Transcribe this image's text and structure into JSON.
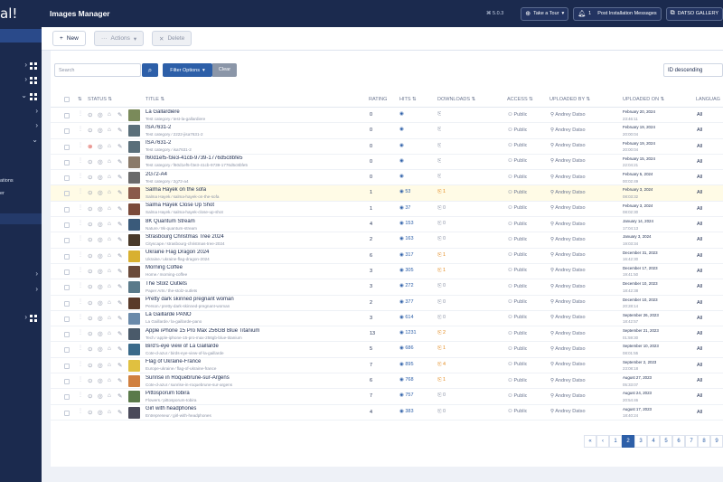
{
  "app": {
    "logo_text": "al!",
    "title": "Images Manager",
    "version": "5.0.3"
  },
  "topbar": {
    "take_tour": "Take a Tour",
    "messages_count": "1",
    "messages_label": "Post Installation Messages",
    "gallery_label": "DATSO GALLERY"
  },
  "sidebar": {
    "text_a": "ations",
    "text_b": "er"
  },
  "toolbar": {
    "new_label": "New",
    "actions_label": "Actions",
    "delete_label": "Delete"
  },
  "filters": {
    "search_placeholder": "Search",
    "filter_options_label": "Filter Options",
    "clear_label": "Clear",
    "sort_value": "ID descending"
  },
  "columns": {
    "status": "STATUS",
    "title": "TITLE",
    "rating": "RATING",
    "hits": "HITS",
    "downloads": "DOWNLOADS",
    "access": "ACCESS",
    "uploaded_by": "UPLOADED BY",
    "uploaded_on": "UPLOADED ON",
    "language": "LANGUAG"
  },
  "rows": [
    {
      "title": "La Gallardière",
      "sub": "Test category  ⁄  test-la-gallardiere",
      "rating": "0",
      "hits": "",
      "downloads": "",
      "access": "Public",
      "by": "Andrey Datso",
      "date": "February 20, 2024",
      "time": "23:46:11",
      "lang": "All",
      "status": "ok",
      "thumb": "#7a8a5a"
    },
    {
      "title": "ISA7631-2",
      "sub": "Test category  ⁄  2222-jisa7631-2",
      "rating": "0",
      "hits": "",
      "downloads": "",
      "access": "Public",
      "by": "Andrey Datso",
      "date": "February 19, 2024",
      "time": "20:00:04",
      "lang": "All",
      "status": "ok",
      "thumb": "#5a6f7a"
    },
    {
      "title": "ISA7631-2",
      "sub": "Test category  ⁄  isa7631-2",
      "rating": "0",
      "hits": "",
      "downloads": "",
      "access": "Public",
      "by": "Andrey Datso",
      "date": "February 19, 2024",
      "time": "20:00:04",
      "lang": "All",
      "status": "err",
      "thumb": "#5a6f7a"
    },
    {
      "title": "f60d1ef5-f3e3-41cb-9739-1776d5c8bfe5",
      "sub": "Test category  ⁄  f60d1ef5-f3e3-41cb-9739-1776d5c8bfe5",
      "rating": "0",
      "hits": "",
      "downloads": "",
      "access": "Public",
      "by": "Andrey Datso",
      "date": "February 15, 2024",
      "time": "22:04:21",
      "lang": "All",
      "status": "ok",
      "thumb": "#8a7a6a"
    },
    {
      "title": "2G72-A4",
      "sub": "Test category  ⁄  2g72-a4",
      "rating": "0",
      "hits": "",
      "downloads": "",
      "access": "Public",
      "by": "Andrey Datso",
      "date": "February 5, 2024",
      "time": "00:02:49",
      "lang": "All",
      "status": "ok",
      "thumb": "#6a6a6a"
    },
    {
      "title": "Salma Hayek on the sofa",
      "sub": "Salma Hayek  ⁄  salma-hayek-on-the-sofa",
      "rating": "1",
      "hits": "53",
      "downloads": "1",
      "access": "Public",
      "by": "Andrey Datso",
      "date": "February 3, 2024",
      "time": "08:03:32",
      "lang": "All",
      "status": "ok",
      "thumb": "#8a5a4a",
      "hl": true
    },
    {
      "title": "Salma Hayek Close Up Shot",
      "sub": "Salma Hayek  ⁄  salma-hayek-close-up-shot",
      "rating": "1",
      "hits": "37",
      "downloads": "0",
      "access": "Public",
      "by": "Andrey Datso",
      "date": "February 3, 2024",
      "time": "08:02:30",
      "lang": "All",
      "status": "ok",
      "thumb": "#7a4a3a"
    },
    {
      "title": "8K Quantum Stream",
      "sub": "Nature  ⁄  8k-quantum-stream",
      "rating": "4",
      "hits": "153",
      "downloads": "0",
      "access": "Public",
      "by": "Andrey Datso",
      "date": "January 14, 2024",
      "time": "17:04:13",
      "lang": "All",
      "status": "ok",
      "thumb": "#3a5a7a"
    },
    {
      "title": "Strasbourg Christmas Tree 2024",
      "sub": "Cityscape  ⁄  strasbourg-christmas-tree-2024",
      "rating": "2",
      "hits": "163",
      "downloads": "0",
      "access": "Public",
      "by": "Andrey Datso",
      "date": "January 3, 2024",
      "time": "19:03:34",
      "lang": "All",
      "status": "ok",
      "thumb": "#4a3a2a"
    },
    {
      "title": "Ukraine Flag Dragon 2024",
      "sub": "Ukraine  ⁄  ukraine-flag-dragon-2024",
      "rating": "6",
      "hits": "317",
      "downloads": "1",
      "access": "Public",
      "by": "Andrey Datso",
      "date": "December 31, 2023",
      "time": "16:42:30",
      "lang": "All",
      "status": "ok",
      "thumb": "#d8b030"
    },
    {
      "title": "Morning Coffee",
      "sub": "Home  ⁄  morning-coffee",
      "rating": "3",
      "hits": "305",
      "downloads": "1",
      "access": "Public",
      "by": "Andrey Datso",
      "date": "December 17, 2023",
      "time": "19:41:50",
      "lang": "All",
      "status": "ok",
      "thumb": "#6a4a3a"
    },
    {
      "title": "The Stolz Outlets",
      "sub": "Paper Arts  ⁄  the-stolz-outlets",
      "rating": "3",
      "hits": "272",
      "downloads": "0",
      "access": "Public",
      "by": "Andrey Datso",
      "date": "December 10, 2023",
      "time": "18:42:38",
      "lang": "All",
      "status": "ok",
      "thumb": "#5a7a8a"
    },
    {
      "title": "Pretty dark skinned pregnant woman",
      "sub": "Person  ⁄  pretty-dark-skinned-pregnant-woman",
      "rating": "2",
      "hits": "377",
      "downloads": "0",
      "access": "Public",
      "by": "Andrey Datso",
      "date": "December 10, 2023",
      "time": "20:28:14",
      "lang": "All",
      "status": "ok",
      "thumb": "#5a3a2a"
    },
    {
      "title": "La Gaillarde PANO",
      "sub": "La Gaillarde  ⁄  la-gaillarde-pano",
      "rating": "3",
      "hits": "614",
      "downloads": "0",
      "access": "Public",
      "by": "Andrey Datso",
      "date": "September 26, 2023",
      "time": "18:42:57",
      "lang": "All",
      "status": "ok",
      "thumb": "#6a8aaa"
    },
    {
      "title": "Apple iPhone 15 Pro Max 256GB Blue Titanium",
      "sub": "Tech  ⁄  apple-iphone-15-pro-max-256gb-blue-titanium",
      "rating": "13",
      "hits": "1231",
      "downloads": "2",
      "access": "Public",
      "by": "Andrey Datso",
      "date": "September 21, 2023",
      "time": "01:59:30",
      "lang": "All",
      "status": "ok",
      "thumb": "#4a5a6a"
    },
    {
      "title": "Bird's-eye view of La Gaillarde",
      "sub": "Cote-d-azur  ⁄  birds-eye-view-of-la-gaillarde",
      "rating": "5",
      "hits": "686",
      "downloads": "1",
      "access": "Public",
      "by": "Andrey Datso",
      "date": "September 10, 2023",
      "time": "08:01:55",
      "lang": "All",
      "status": "ok",
      "thumb": "#3a6a8a"
    },
    {
      "title": "Flag of Ukraine-France",
      "sub": "Europe-ukraine  ⁄  flag-of-ukraine-france",
      "rating": "7",
      "hits": "895",
      "downloads": "4",
      "access": "Public",
      "by": "Andrey Datso",
      "date": "September 2, 2023",
      "time": "23:08:18",
      "lang": "All",
      "status": "ok",
      "thumb": "#e0c040"
    },
    {
      "title": "Sunrise in Roquebrune-sur-Argens",
      "sub": "Cote-d-azur  ⁄  sunrise-in-roquebrune-sur-argens",
      "rating": "6",
      "hits": "768",
      "downloads": "1",
      "access": "Public",
      "by": "Andrey Datso",
      "date": "August 27, 2023",
      "time": "05:33:07",
      "lang": "All",
      "status": "ok",
      "thumb": "#d08040"
    },
    {
      "title": "Pittosporum tobira",
      "sub": "Flowers  ⁄  pittosporum-tobira",
      "rating": "7",
      "hits": "757",
      "downloads": "0",
      "access": "Public",
      "by": "Andrey Datso",
      "date": "August 24, 2023",
      "time": "20:54:46",
      "lang": "All",
      "status": "ok",
      "thumb": "#5a7a4a"
    },
    {
      "title": "Girl with headphones",
      "sub": "Entrepreneur  ⁄  girl-with-headphones",
      "rating": "4",
      "hits": "383",
      "downloads": "0",
      "access": "Public",
      "by": "Andrey Datso",
      "date": "August 17, 2023",
      "time": "18:40:24",
      "lang": "All",
      "status": "ok",
      "thumb": "#4a4a5a"
    }
  ],
  "pagination": {
    "first": "«",
    "prev": "‹",
    "pages": [
      "1",
      "2",
      "3",
      "4",
      "5",
      "6",
      "7",
      "8",
      "9"
    ],
    "active": "2"
  }
}
